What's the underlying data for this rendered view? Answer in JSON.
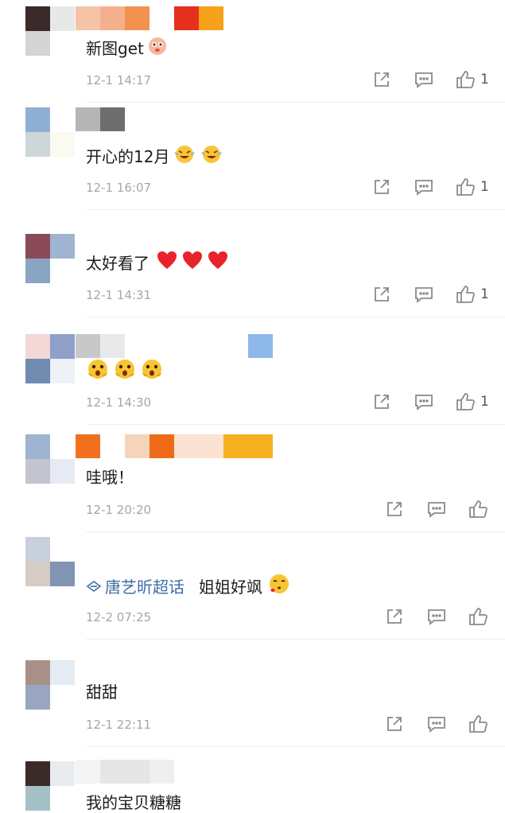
{
  "colors": {
    "text": "#1b1b1b",
    "time": "#a6a6a6",
    "link": "#3f6ea8",
    "icon": "#8a8a8a"
  },
  "comments": [
    {
      "text": "新图get",
      "emojis": [
        "shy-icon"
      ],
      "time": "12-1 14:17",
      "likes": "1"
    },
    {
      "text": "开心的12月",
      "emojis": [
        "tears-of-joy-icon",
        "tears-of-joy-icon"
      ],
      "time": "12-1 16:07",
      "likes": "1"
    },
    {
      "text": "太好看了",
      "emojis": [
        "heart-icon",
        "heart-icon",
        "heart-icon"
      ],
      "time": "12-1 14:31",
      "likes": "1"
    },
    {
      "text": "",
      "emojis": [
        "shocked-face-icon",
        "shocked-face-icon",
        "shocked-face-icon"
      ],
      "time": "12-1 14:30",
      "likes": "1"
    },
    {
      "text": "哇哦！",
      "emojis": [],
      "time": "12-1 20:20",
      "likes": ""
    },
    {
      "supertopic": "唐艺昕超话",
      "text": "姐姐好飒",
      "emojis": [
        "kiss-face-icon"
      ],
      "time": "12-2 07:25",
      "likes": ""
    },
    {
      "text": "甜甜",
      "emojis": [],
      "time": "12-1 22:11",
      "likes": ""
    },
    {
      "text": "我的宝贝糖糖",
      "emojis": [],
      "time": "",
      "likes": ""
    }
  ]
}
